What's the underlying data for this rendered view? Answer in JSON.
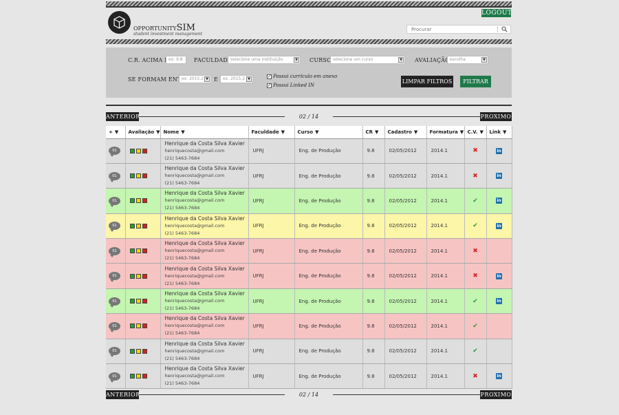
{
  "header": {
    "logout_label": "LOGOUT",
    "logo_word1": "OPPORTUNITY",
    "logo_word2": "SIM",
    "logo_tagline": "student investment management",
    "search_placeholder": "Procurar"
  },
  "filters": {
    "cr_label": "C.R. ACIMA DE",
    "cr_placeholder": "ex: 9.8",
    "faculdade_label": "FACULDADE",
    "faculdade_value": "selecione uma instituição",
    "curso_label": "CURSO",
    "curso_value": "selecione um curso",
    "avaliacao_label": "AVALIAÇÃO",
    "avaliacao_value": "escolha",
    "formam_label": "SE FORMAM ENTRE",
    "formam_from": "ex: 2015.2",
    "e_label": "E",
    "formam_to": "ex: 2015.2",
    "chk_curriculo": "Possui currículo em anexo",
    "chk_linkedin": "Possui Linked IN",
    "clear_label": "LIMPAR FILTROS",
    "filter_label": "FILTRAR"
  },
  "pager": {
    "prev": "ANTERIOR",
    "next": "PROXIMO",
    "page": "02 / 14"
  },
  "table": {
    "headers": [
      "+",
      "Avaliação",
      "Nome",
      "Faculdade",
      "Curso",
      "CR",
      "Cadastro",
      "Formatura",
      "C.V.",
      "Link"
    ],
    "rows": [
      {
        "status": "gray",
        "comments": "01",
        "name": "Henrique da Costa Silva Xavier",
        "email": "henriquecosta@gmail.com",
        "phone": "(21) 5463-7684",
        "faculdade": "UFRJ",
        "curso": "Eng. de Produção",
        "cr": "9.8",
        "cadastro": "02/05/2012",
        "formatura": "2014.1",
        "cv": "no",
        "link": true
      },
      {
        "status": "gray",
        "comments": "01",
        "name": "Henrique da Costa Silva Xavier",
        "email": "henriquecosta@gmail.com",
        "phone": "(21) 5463-7684",
        "faculdade": "UFRJ",
        "curso": "Eng. de Produção",
        "cr": "9.8",
        "cadastro": "02/05/2012",
        "formatura": "2014.1",
        "cv": "no",
        "link": true
      },
      {
        "status": "green",
        "comments": "01",
        "name": "Henrique da Costa Silva Xavier",
        "email": "henriquecosta@gmail.com",
        "phone": "(21) 5463-7684",
        "faculdade": "UFRJ",
        "curso": "Eng. de Produção",
        "cr": "9.8",
        "cadastro": "02/05/2012",
        "formatura": "2014.1",
        "cv": "yes",
        "link": true
      },
      {
        "status": "yellow",
        "comments": "01",
        "name": "Henrique da Costa Silva Xavier",
        "email": "henriquecosta@gmail.com",
        "phone": "(21) 5463-7684",
        "faculdade": "UFRJ",
        "curso": "Eng. de Produção",
        "cr": "9.8",
        "cadastro": "02/05/2012",
        "formatura": "2014.1",
        "cv": "yes",
        "link": true
      },
      {
        "status": "red",
        "comments": "01",
        "name": "Henrique da Costa Silva Xavier",
        "email": "henriquecosta@gmail.com",
        "phone": "(21) 5463-7684",
        "faculdade": "UFRJ",
        "curso": "Eng. de Produção",
        "cr": "9.8",
        "cadastro": "02/05/2012",
        "formatura": "2014.1",
        "cv": "no",
        "link": false
      },
      {
        "status": "red",
        "comments": "01",
        "name": "Henrique da Costa Silva Xavier",
        "email": "henriquecosta@gmail.com",
        "phone": "(21) 5463-7684",
        "faculdade": "UFRJ",
        "curso": "Eng. de Produção",
        "cr": "9.8",
        "cadastro": "02/05/2012",
        "formatura": "2014.1",
        "cv": "no",
        "link": true
      },
      {
        "status": "green",
        "comments": "01",
        "name": "Henrique da Costa Silva Xavier",
        "email": "henriquecosta@gmail.com",
        "phone": "(21) 5463-7684",
        "faculdade": "UFRJ",
        "curso": "Eng. de Produção",
        "cr": "9.8",
        "cadastro": "02/05/2012",
        "formatura": "2014.1",
        "cv": "yes",
        "link": true
      },
      {
        "status": "red",
        "comments": "01",
        "name": "Henrique da Costa Silva Xavier",
        "email": "henriquecosta@gmail.com",
        "phone": "(21) 5463-7684",
        "faculdade": "UFRJ",
        "curso": "Eng. de Produção",
        "cr": "9.8",
        "cadastro": "02/05/2012",
        "formatura": "2014.1",
        "cv": "yes",
        "link": false
      },
      {
        "status": "gray",
        "comments": "01",
        "name": "Henrique da Costa Silva Xavier",
        "email": "henriquecosta@gmail.com",
        "phone": "(21) 5463-7684",
        "faculdade": "UFRJ",
        "curso": "Eng. de Produção",
        "cr": "9.8",
        "cadastro": "02/05/2012",
        "formatura": "2014.1",
        "cv": "yes",
        "link": false
      },
      {
        "status": "gray",
        "comments": "01",
        "name": "Henrique da Costa Silva Xavier",
        "email": "henriquecosta@gmail.com",
        "phone": "(21) 5463-7684",
        "faculdade": "UFRJ",
        "curso": "Eng. de Produção",
        "cr": "9.8",
        "cadastro": "02/05/2012",
        "formatura": "2014.1",
        "cv": "no",
        "link": true
      }
    ]
  },
  "colors": {
    "accent_green": "#1f7a4a",
    "row_green": "#c4f5b1",
    "row_yellow": "#fbf6a8",
    "row_red": "#f7c4c4",
    "row_gray": "#dedede"
  }
}
